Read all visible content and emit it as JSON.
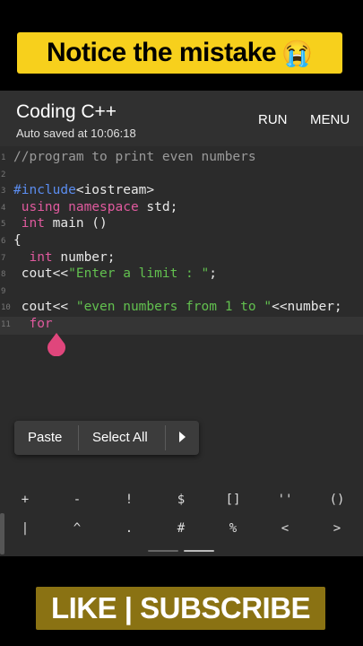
{
  "banner_top": {
    "text": "Notice the mistake",
    "emoji": "😭"
  },
  "app": {
    "title": "Coding C++",
    "subtitle": "Auto saved at 10:06:18",
    "run_label": "RUN",
    "menu_label": "MENU"
  },
  "editor": {
    "line_numbers": [
      "1",
      "2",
      "3",
      "4",
      "5",
      "6",
      "7",
      "8",
      "9",
      "10",
      "11"
    ],
    "lines": [
      {
        "segs": [
          {
            "t": "//program to print even numbers",
            "c": "com"
          }
        ]
      },
      {
        "segs": []
      },
      {
        "segs": [
          {
            "t": "#include",
            "c": "pp"
          },
          {
            "t": "<iostream>",
            "c": "pl"
          }
        ]
      },
      {
        "segs": [
          {
            "t": " using",
            "c": "kw"
          },
          {
            "t": " ",
            "c": "pl"
          },
          {
            "t": "namespace",
            "c": "kw"
          },
          {
            "t": " std;",
            "c": "pl"
          }
        ]
      },
      {
        "segs": [
          {
            "t": " int",
            "c": "kw"
          },
          {
            "t": " main ()",
            "c": "pl"
          }
        ]
      },
      {
        "segs": [
          {
            "t": "{",
            "c": "pl"
          }
        ]
      },
      {
        "segs": [
          {
            "t": "  int",
            "c": "kw"
          },
          {
            "t": " number;",
            "c": "pl"
          }
        ]
      },
      {
        "segs": [
          {
            "t": " cout<<",
            "c": "pl"
          },
          {
            "t": "\"Enter a limit : \"",
            "c": "str"
          },
          {
            "t": ";",
            "c": "pl"
          }
        ]
      },
      {
        "segs": []
      },
      {
        "segs": [
          {
            "t": " cout<< ",
            "c": "pl"
          },
          {
            "t": "\"even numbers from 1 to \"",
            "c": "str"
          },
          {
            "t": "<<number;",
            "c": "pl"
          }
        ]
      },
      {
        "segs": [
          {
            "t": "  for",
            "c": "kw"
          }
        ]
      }
    ]
  },
  "context_menu": {
    "paste": "Paste",
    "select_all": "Select All"
  },
  "keyboard_row1": [
    "+",
    "-",
    "!",
    "$",
    "[]",
    "''",
    "()"
  ],
  "keyboard_row2": [
    "|",
    "^",
    ".",
    "#",
    "%",
    "<",
    ">"
  ],
  "banner_bottom": {
    "text": "LIKE | SUBSCRIBE"
  }
}
